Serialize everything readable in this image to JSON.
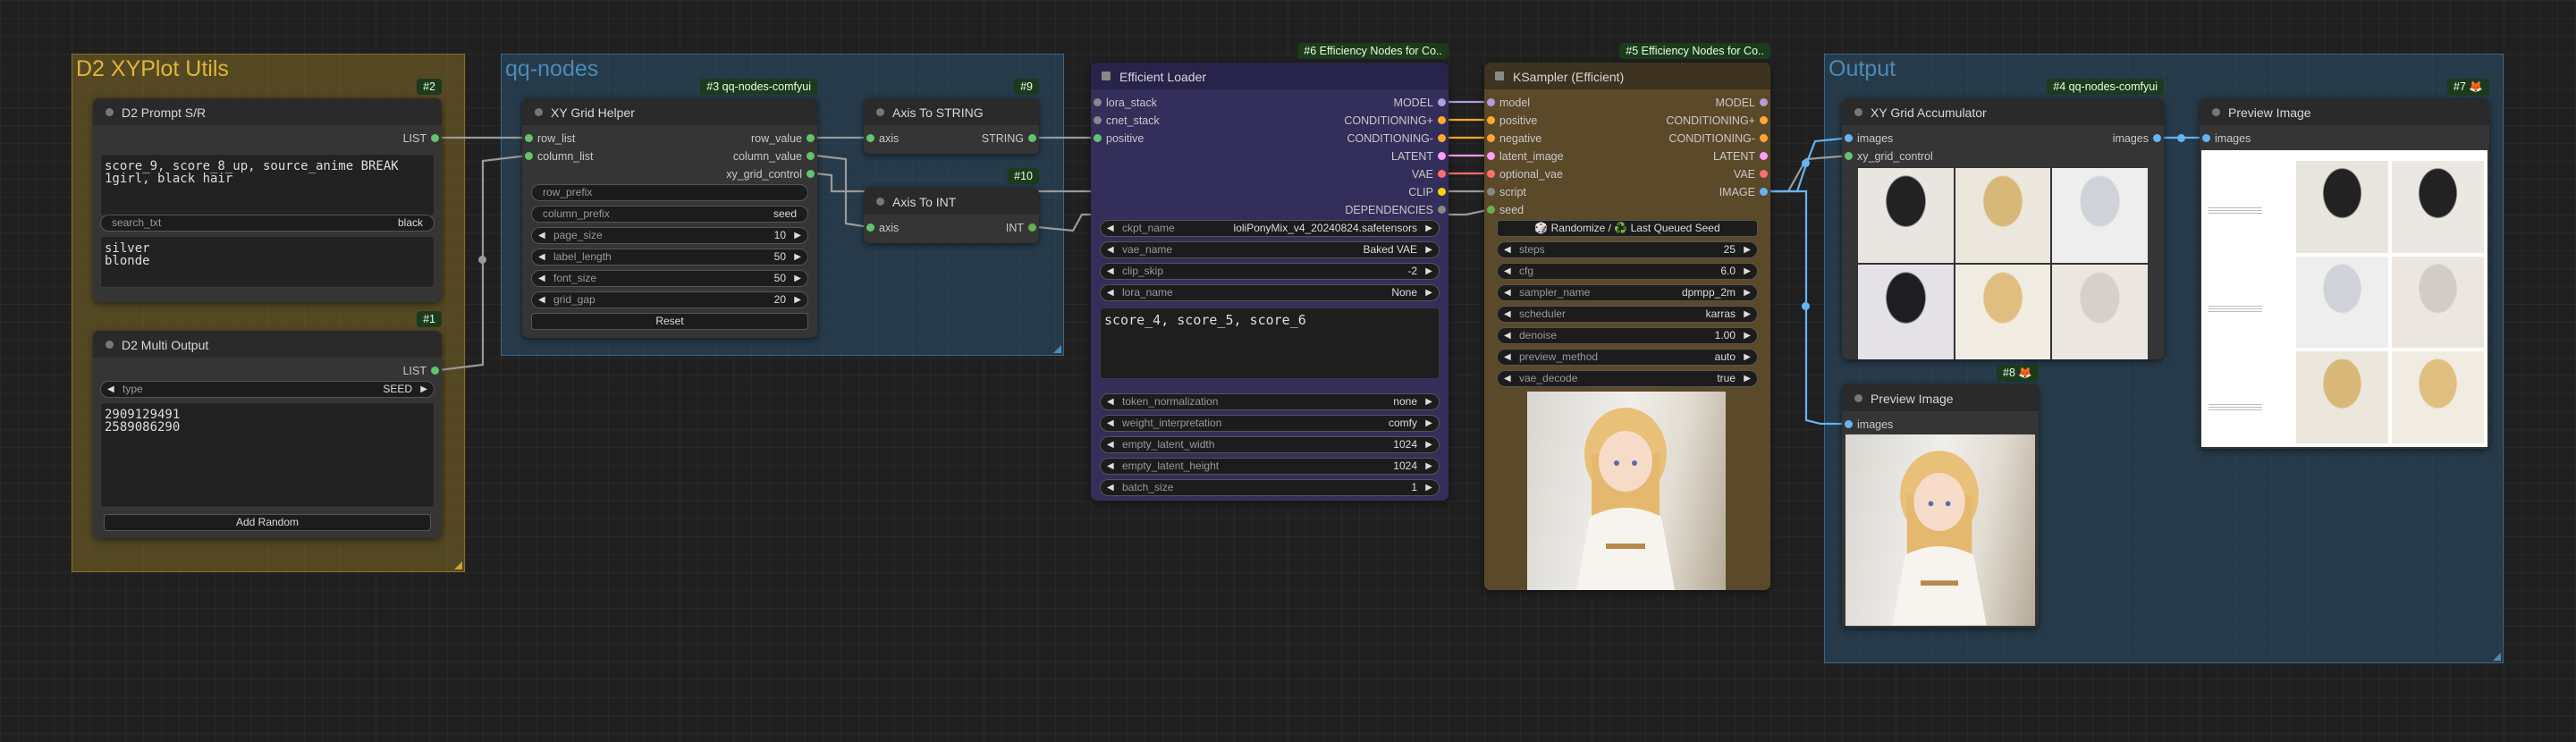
{
  "colors": {
    "string": "#63c46b",
    "int": "#6ab04c",
    "model": "#b39ddb",
    "conditioning": "#ffa931",
    "latent": "#ff9cf9",
    "vae": "#ff6e6e",
    "clip": "#ffd500",
    "image": "#64b5f6",
    "grey": "#888888"
  },
  "groups": {
    "xyplot": {
      "title": "D2 XYPlot Utils"
    },
    "qq": {
      "title": "qq-nodes"
    },
    "output": {
      "title": "Output"
    }
  },
  "prompt_sr": {
    "badge": "#2",
    "title": "D2 Prompt S/R",
    "out_list": "LIST",
    "prompt_text": "score_9, score_8_up, source_anime BREAK\n1girl, black hair",
    "search_label": "search_txt",
    "search_value": "black",
    "replace_text": "silver\nblonde"
  },
  "multi_output": {
    "badge": "#1",
    "title": "D2 Multi Output",
    "out_list": "LIST",
    "type_label": "type",
    "type_value": "SEED",
    "seeds_text": "2909129491\n2589086290",
    "add_random": "Add Random"
  },
  "xy_grid_helper": {
    "badge": "#3 qq-nodes-comfyui",
    "title": "XY Grid Helper",
    "in_row": "row_list",
    "in_col": "column_list",
    "out_row": "row_value",
    "out_col": "column_value",
    "out_ctl": "xy_grid_control",
    "row_prefix": "row_prefix",
    "column_prefix": "column_prefix",
    "column_prefix_value": "seed",
    "page_size_l": "page_size",
    "page_size_v": "10",
    "label_length_l": "label_length",
    "label_length_v": "50",
    "font_size_l": "font_size",
    "font_size_v": "50",
    "grid_gap_l": "grid_gap",
    "grid_gap_v": "20",
    "reset": "Reset"
  },
  "axis_string": {
    "badge": "#9",
    "title": "Axis To STRING",
    "in": "axis",
    "out": "STRING"
  },
  "axis_int": {
    "badge": "#10",
    "title": "Axis To INT",
    "in": "axis",
    "out": "INT"
  },
  "eff_loader": {
    "badge": "#6 Efficiency Nodes for Co..",
    "title": "Efficient Loader",
    "in_lora": "lora_stack",
    "in_cnet": "cnet_stack",
    "in_pos": "positive",
    "out_model": "MODEL",
    "out_cond1": "CONDITIONING+",
    "out_cond2": "CONDITIONING-",
    "out_latent": "LATENT",
    "out_vae": "VAE",
    "out_clip": "CLIP",
    "out_dep": "DEPENDENCIES",
    "ckpt_l": "ckpt_name",
    "ckpt_v": "loliPonyMix_v4_20240824.safetensors",
    "vae_l": "vae_name",
    "vae_v": "Baked VAE",
    "clip_l": "clip_skip",
    "clip_v": "-2",
    "lora_l": "lora_name",
    "lora_v": "None",
    "neg_text": "score_4, score_5, score_6",
    "tok_l": "token_normalization",
    "tok_v": "none",
    "wi_l": "weight_interpretation",
    "wi_v": "comfy",
    "elw_l": "empty_latent_width",
    "elw_v": "1024",
    "elh_l": "empty_latent_height",
    "elh_v": "1024",
    "bs_l": "batch_size",
    "bs_v": "1"
  },
  "ksampler": {
    "badge": "#5 Efficiency Nodes for Co..",
    "title": "KSampler (Efficient)",
    "in_model": "model",
    "in_pos": "positive",
    "in_neg": "negative",
    "in_latent": "latent_image",
    "in_vae": "optional_vae",
    "in_script": "script",
    "in_seed": "seed",
    "out_model": "MODEL",
    "out_cond1": "CONDITIONING+",
    "out_cond2": "CONDITIONING-",
    "out_latent": "LATENT",
    "out_vae": "VAE",
    "out_image": "IMAGE",
    "seed_btn": "🎲 Randomize / ♻️ Last Queued Seed",
    "steps_l": "steps",
    "steps_v": "25",
    "cfg_l": "cfg",
    "cfg_v": "6.0",
    "sampler_l": "sampler_name",
    "sampler_v": "dpmpp_2m",
    "sched_l": "scheduler",
    "sched_v": "karras",
    "denoise_l": "denoise",
    "denoise_v": "1.00",
    "prev_l": "preview_method",
    "prev_v": "auto",
    "vaed_l": "vae_decode",
    "vaed_v": "true"
  },
  "xy_acc": {
    "badge": "#4 qq-nodes-comfyui",
    "title": "XY Grid Accumulator",
    "in_images": "images",
    "in_ctl": "xy_grid_control",
    "out_images": "images"
  },
  "preview7": {
    "badge": "#7 🦊",
    "title": "Preview Image",
    "in_images": "images"
  },
  "preview8": {
    "badge": "#8 🦊",
    "title": "Preview Image",
    "in_images": "images"
  }
}
